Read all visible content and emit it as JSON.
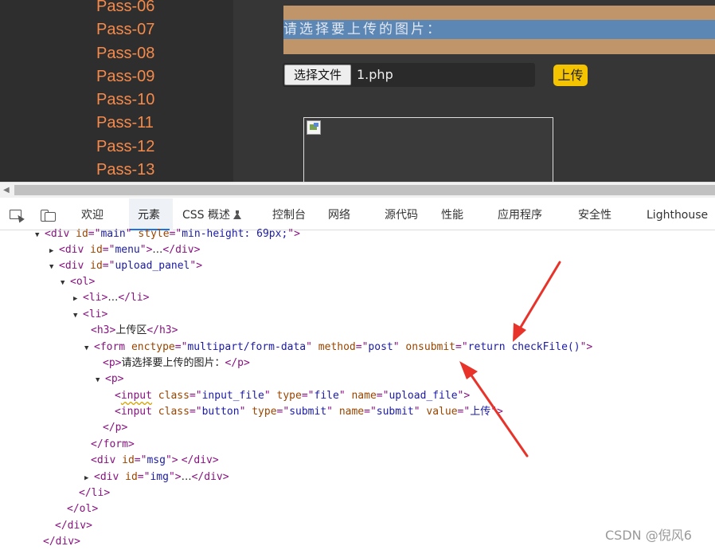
{
  "page": {
    "pass_links": [
      "Pass-06",
      "Pass-07",
      "Pass-08",
      "Pass-09",
      "Pass-10",
      "Pass-11",
      "Pass-12",
      "Pass-13"
    ],
    "upload_prompt": "请选择要上传的图片：",
    "choose_file_label": "选择文件",
    "file_name": "1.php",
    "upload_button_label": "上传"
  },
  "devtools": {
    "tabs": [
      "欢迎",
      "元素",
      "CSS 概述",
      "控制台",
      "网络",
      "源代码",
      "性能",
      "应用程序",
      "安全性",
      "Lighthouse"
    ],
    "active_tab": "元素",
    "dom_lines": [
      {
        "markup": "<div id=\"main\" style=\"min-height: 69px;\">"
      },
      {
        "markup": "<div id=\"menu\">…</div>"
      },
      {
        "markup": "<div id=\"upload_panel\">"
      },
      {
        "markup": "<ol>"
      },
      {
        "markup": "<li>…</li>"
      },
      {
        "markup": "<li>"
      },
      {
        "markup": "<h3>上传区</h3>"
      },
      {
        "markup": "<form enctype=\"multipart/form-data\" method=\"post\" onsubmit=\"return checkFile()\">"
      },
      {
        "markup": "<p>请选择要上传的图片：</p>"
      },
      {
        "markup": "<p>"
      },
      {
        "markup": "<input class=\"input_file\" type=\"file\" name=\"upload_file\">"
      },
      {
        "markup": "<input class=\"button\" type=\"submit\" name=\"submit\" value=\"上传\">"
      },
      {
        "markup": "</p>"
      },
      {
        "markup": "</form>"
      },
      {
        "markup": "<div id=\"msg\"> </div>"
      },
      {
        "markup": "<div id=\"img\">…</div>"
      },
      {
        "markup": "</li>"
      },
      {
        "markup": "</ol>"
      },
      {
        "markup": "</div>"
      },
      {
        "markup": "</div>"
      }
    ]
  },
  "watermark": "CSDN @倪风6",
  "colors": {
    "pass_link": "#f58a4b",
    "upload_button": "#f5c400",
    "active_tab_underline": "#1a73e8",
    "arrow": "#e8332a"
  }
}
